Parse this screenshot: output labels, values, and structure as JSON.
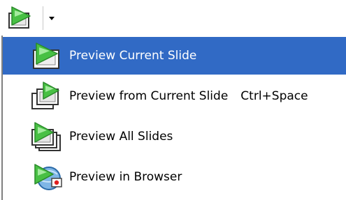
{
  "toolbar": {
    "button_icon": "slide-preview-icon",
    "dropdown_icon": "chevron-down-icon"
  },
  "menu": {
    "items": [
      {
        "label": "Preview Current Slide",
        "shortcut": "",
        "icon": "preview-current-slide-icon",
        "selected": true
      },
      {
        "label": "Preview from Current Slide",
        "shortcut": "Ctrl+Space",
        "icon": "preview-from-current-slide-icon",
        "selected": false
      },
      {
        "label": "Preview All Slides",
        "shortcut": "",
        "icon": "preview-all-slides-icon",
        "selected": false
      },
      {
        "label": "Preview in Browser",
        "shortcut": "",
        "icon": "preview-in-browser-icon",
        "selected": false
      }
    ]
  },
  "colors": {
    "selection": "#316ac5",
    "icon_green": "#3ab54a",
    "menu_border": "#808080"
  }
}
